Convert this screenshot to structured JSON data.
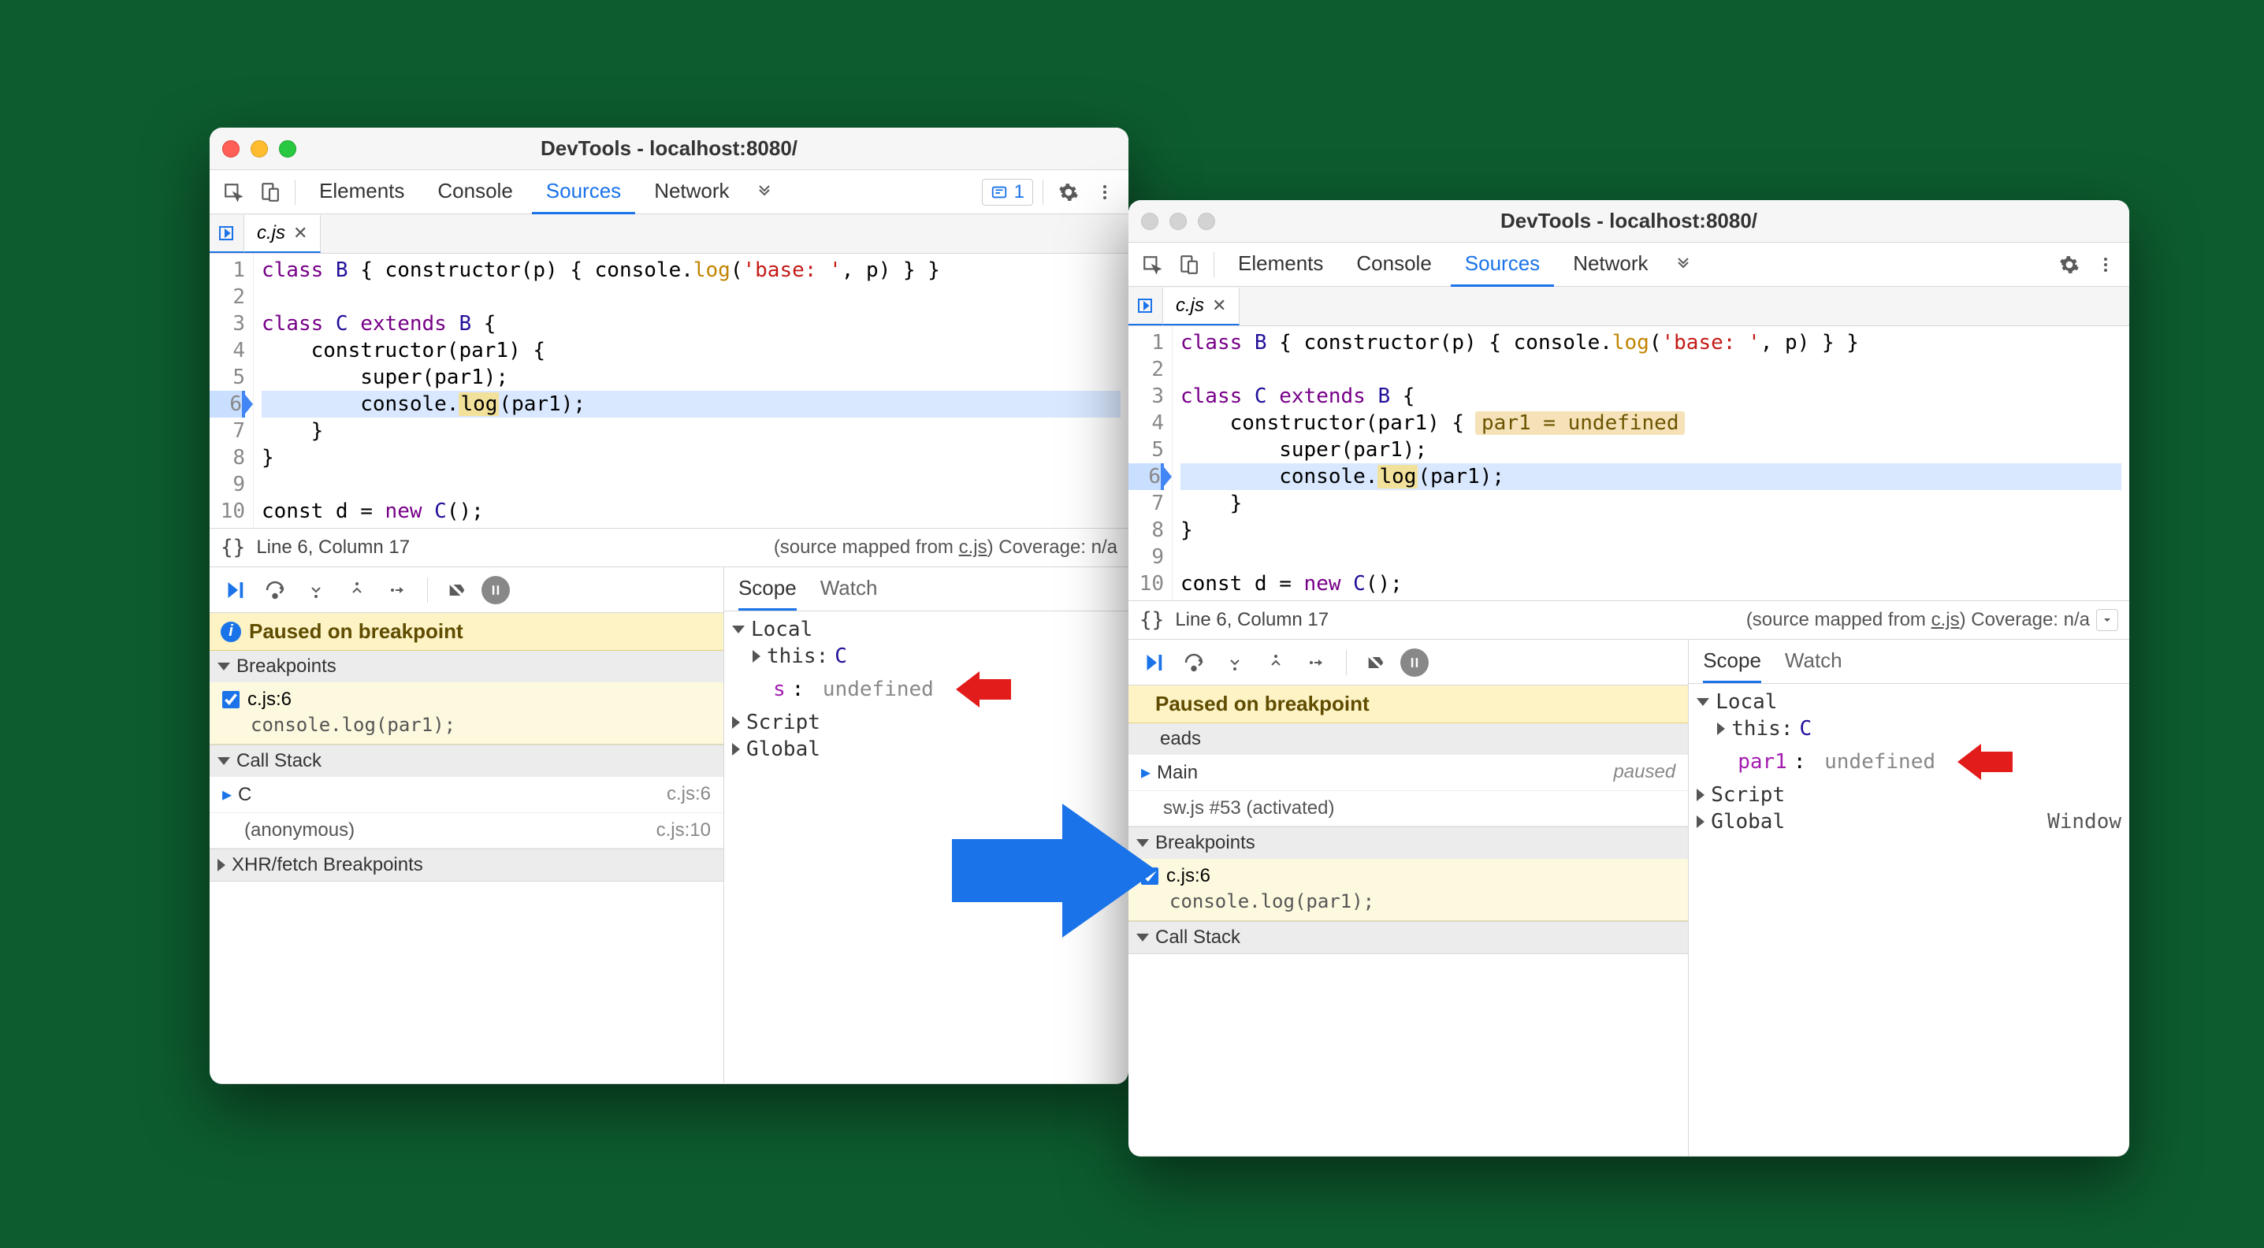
{
  "title": "DevTools - localhost:8080/",
  "tabs": {
    "elements": "Elements",
    "console": "Console",
    "sources": "Sources",
    "network": "Network"
  },
  "file_tab": "c.js",
  "issues_count": "1",
  "code": {
    "lines": [
      "1",
      "2",
      "3",
      "4",
      "5",
      "6",
      "7",
      "8",
      "9",
      "10"
    ],
    "l1_a": "class ",
    "l1_b": "B",
    "l1_c": " { constructor(p) { console.",
    "l1_d": "log",
    "l1_e": "(",
    "l1_f": "'base: '",
    "l1_g": ", p) } }",
    "l3_a": "class ",
    "l3_b": "C",
    "l3_c": " extends ",
    "l3_d": "B",
    "l3_e": " {",
    "l4_a": "    constructor(par1) {",
    "l4_inline": "par1 = undefined",
    "l5_a": "        super(par1);",
    "l6_a": "        console.",
    "l6_b": "log",
    "l6_c": "(par1);",
    "l7": "    }",
    "l8": "}",
    "l10_a": "const d = ",
    "l10_b": "new",
    "l10_c": " C",
    "l10_d": "();"
  },
  "status": {
    "pos": "Line 6, Column 17",
    "map_prefix": "(source mapped from ",
    "map_file": "c.js",
    "map_suffix1": ") Coverage: n/a",
    "map_suffix_trunc": ") Coverage: n/a"
  },
  "paused": "Paused on breakpoint",
  "sections": {
    "breakpoints": "Breakpoints",
    "callstack": "Call Stack",
    "xhr": "XHR/fetch Breakpoints",
    "threads": "Threads"
  },
  "bp": {
    "loc": "c.js:6",
    "snippet": "console.log(par1);"
  },
  "callstack": {
    "c": "C",
    "c_loc": "c.js:6",
    "anon": "(anonymous)",
    "anon_loc": "c.js:10"
  },
  "threads": {
    "main": "Main",
    "paused": "paused",
    "sw": "sw.js #53 (activated)"
  },
  "scope": {
    "tab_scope": "Scope",
    "tab_watch": "Watch",
    "local": "Local",
    "this": "this: ",
    "this_val": "C",
    "left_var": "s",
    "right_var": "par1",
    "undef": "undefined",
    "script": "Script",
    "global": "Global",
    "window": "Window"
  }
}
